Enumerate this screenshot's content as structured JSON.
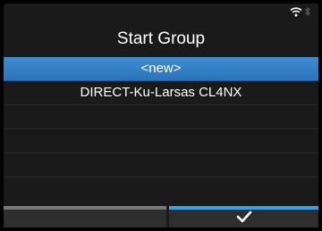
{
  "screen": {
    "title": "Start Group"
  },
  "status": {
    "icons": [
      "wifi-icon",
      "bluetooth-icon"
    ]
  },
  "list": {
    "items": [
      {
        "label": "<new>",
        "selected": true
      },
      {
        "label": "DIRECT-Ku-Larsas CL4NX",
        "selected": false
      }
    ]
  },
  "softkeys": {
    "left": {
      "label": ""
    },
    "right": {
      "icon": "checkmark-icon"
    }
  },
  "colors": {
    "selection": "#2f7cc4",
    "accent": "#33a5ea",
    "background": "#1a1a1a"
  }
}
